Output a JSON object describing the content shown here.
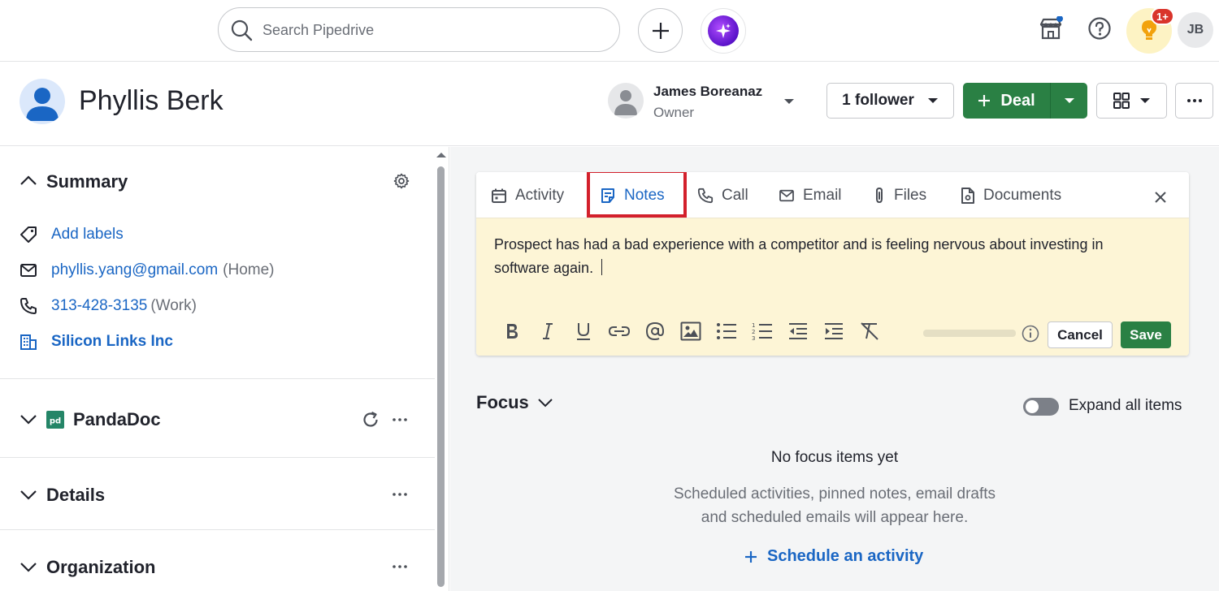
{
  "topbar": {
    "search_placeholder": "Search Pipedrive",
    "notification_badge": "1+",
    "user_initials": "JB"
  },
  "person": {
    "name": "Phyllis Berk",
    "owner_name": "James Boreanaz",
    "owner_role": "Owner",
    "follower_label": "1 follower",
    "deal_label": "Deal"
  },
  "summary": {
    "title": "Summary",
    "add_labels": "Add labels",
    "email": "phyllis.yang@gmail.com",
    "email_type": "(Home)",
    "phone": "313-428-3135",
    "phone_type": "(Work)",
    "organization": "Silicon Links Inc"
  },
  "sections": {
    "pandadoc": "PandaDoc",
    "details": "Details",
    "organization": "Organization"
  },
  "composer": {
    "tabs": [
      "Activity",
      "Notes",
      "Call",
      "Email",
      "Files",
      "Documents"
    ],
    "active_tab": "Notes",
    "note_text": "Prospect has had a bad experience with a competitor and is feeling nervous about investing in software again.",
    "cancel_label": "Cancel",
    "save_label": "Save"
  },
  "focus": {
    "title": "Focus",
    "expand_label": "Expand all items",
    "expand_on": false,
    "empty_title": "No focus items yet",
    "empty_desc_line1": "Scheduled activities, pinned notes, email drafts",
    "empty_desc_line2": "and scheduled emails will appear here.",
    "schedule_link": "Schedule an activity"
  },
  "colors": {
    "brand_green": "#2a8044",
    "link_blue": "#1a66c4",
    "note_bg": "#fdf5d6",
    "highlight_red": "#d3202b"
  }
}
